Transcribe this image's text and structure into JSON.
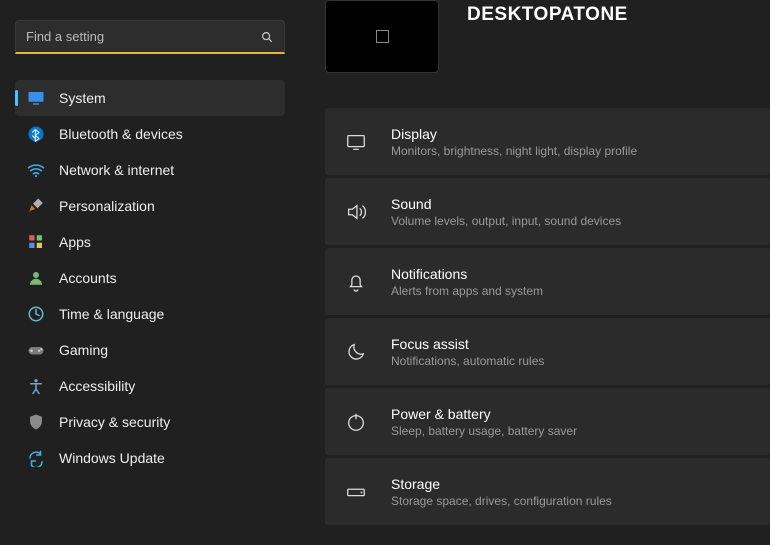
{
  "search": {
    "placeholder": "Find a setting"
  },
  "device": {
    "name": "DESKTOPATONE"
  },
  "nav": [
    {
      "key": "system",
      "label": "System",
      "active": true
    },
    {
      "key": "bluetooth",
      "label": "Bluetooth & devices",
      "active": false
    },
    {
      "key": "network",
      "label": "Network & internet",
      "active": false
    },
    {
      "key": "personalization",
      "label": "Personalization",
      "active": false
    },
    {
      "key": "apps",
      "label": "Apps",
      "active": false
    },
    {
      "key": "accounts",
      "label": "Accounts",
      "active": false
    },
    {
      "key": "time-language",
      "label": "Time & language",
      "active": false
    },
    {
      "key": "gaming",
      "label": "Gaming",
      "active": false
    },
    {
      "key": "accessibility",
      "label": "Accessibility",
      "active": false
    },
    {
      "key": "privacy-security",
      "label": "Privacy & security",
      "active": false
    },
    {
      "key": "windows-update",
      "label": "Windows Update",
      "active": false
    }
  ],
  "settings": [
    {
      "key": "display",
      "title": "Display",
      "desc": "Monitors, brightness, night light, display profile"
    },
    {
      "key": "sound",
      "title": "Sound",
      "desc": "Volume levels, output, input, sound devices"
    },
    {
      "key": "notifications",
      "title": "Notifications",
      "desc": "Alerts from apps and system"
    },
    {
      "key": "focus-assist",
      "title": "Focus assist",
      "desc": "Notifications, automatic rules"
    },
    {
      "key": "power-battery",
      "title": "Power & battery",
      "desc": "Sleep, battery usage, battery saver"
    },
    {
      "key": "storage",
      "title": "Storage",
      "desc": "Storage space, drives, configuration rules"
    }
  ],
  "navIcons": {
    "system": "<svg viewBox='0 0 24 24'><rect x='2' y='4' width='20' height='13' rx='1' fill='#3a8ee6' stroke='none'/><rect x='8' y='19' width='8' height='2' fill='#3a8ee6'/></svg>",
    "bluetooth": "<svg viewBox='0 0 24 24'><circle cx='12' cy='12' r='10' fill='#0078d4'/><path d='M11 6l5 4-5 4 5 4-5 4V6l-4 4m0 4l4 4' stroke='#fff' stroke-width='1.3' fill='none' stroke-linejoin='round'/></svg>",
    "network": "<svg viewBox='0 0 24 24'><path d='M2 9a16 16 0 0 1 20 0M5 13a11 11 0 0 1 14 0M8.5 17a6 6 0 0 1 7 0' stroke='#3fb0e8' stroke-width='2' fill='none' stroke-linecap='round'/><circle cx='12' cy='20' r='1.5' fill='#3fb0e8'/></svg>",
    "personalization": "<svg viewBox='0 0 24 24'><path d='M3 20l3-9 5 5-9 3z' fill='#d67a2c'/><path d='M8 9l7-7 6 6-7 7' fill='#b0b0b0'/></svg>",
    "apps": "<svg viewBox='0 0 24 24'><rect x='3' y='3' width='7' height='7' fill='#e25b5b'/><rect x='13' y='3' width='7' height='7' fill='#6fc36f'/><rect x='3' y='13' width='7' height='7' fill='#5b8ee2'/><rect x='13' y='13' width='7' height='7' fill='#e2c45b'/></svg>",
    "accounts": "<svg viewBox='0 0 24 24'><circle cx='12' cy='8' r='4' fill='#7ab87a'/><path d='M4 21a8 8 0 0 1 16 0z' fill='#7ab87a'/></svg>",
    "time-language": "<svg viewBox='0 0 24 24'><circle cx='12' cy='12' r='9' stroke='#61b8d4' stroke-width='2' fill='none'/><path d='M12 6v6l4 2' stroke='#61b8d4' stroke-width='2' fill='none' stroke-linecap='round'/></svg>",
    "gaming": "<svg viewBox='0 0 24 24'><rect x='2' y='8' width='20' height='10' rx='5' fill='#7a7a7a'/><circle cx='16' cy='13' r='1.5' fill='#ccc'/><circle cx='19' cy='11' r='1.5' fill='#ccc'/><path d='M6 11v4M4 13h4' stroke='#ccc' stroke-width='1.5'/></svg>",
    "accessibility": "<svg viewBox='0 0 24 24'><circle cx='12' cy='5' r='2.2' fill='#6fa7d4'/><path d='M5 9h14M12 9v7m0 0l-4 6m4-6l4 6' stroke='#6fa7d4' stroke-width='2' stroke-linecap='round'/></svg>",
    "privacy-security": "<svg viewBox='0 0 24 24'><path d='M12 2l8 3v6c0 5-3.5 9-8 11-4.5-2-8-6-8-11V5l8-3z' fill='#8a8a8a'/></svg>",
    "windows-update": "<svg viewBox='0 0 24 24'><path d='M4 12a8 8 0 0 1 14-5m2 10a8 8 0 0 1-14 5' stroke='#3fb0e8' stroke-width='2' fill='none' stroke-linecap='round'/><path d='M18 3v5h-5M6 21v-5h5' stroke='#3fb0e8' stroke-width='2' fill='none' stroke-linecap='round'/></svg>"
  },
  "settingIcons": {
    "display": "<svg viewBox='0 0 24 24'><rect x='3' y='5' width='18' height='12' rx='1'/><path d='M9 20h6'/></svg>",
    "sound": "<svg viewBox='0 0 24 24'><path d='M4 9v6h4l5 4V5L8 9H4z'/><path d='M16 8a5 5 0 0 1 0 8M19 5a9 9 0 0 1 0 14'/></svg>",
    "notifications": "<svg viewBox='0 0 24 24'><path d='M6 17h12l-1.5-2V10a4.5 4.5 0 0 0-9 0v5L6 17zM10 20a2 2 0 0 0 4 0'/></svg>",
    "focus-assist": "<svg viewBox='0 0 24 24'><path d='M20 14A8 8 0 0 1 10 4a8 8 0 1 0 10 10z'/></svg>",
    "power-battery": "<svg viewBox='0 0 24 24'><circle cx='12' cy='13' r='8'/><path d='M12 3v6'/></svg>",
    "storage": "<svg viewBox='0 0 24 24'><rect x='3' y='9' width='18' height='7' rx='1'/><circle cx='18' cy='12.5' r='1' fill='#ddd' stroke='none'/></svg>"
  }
}
